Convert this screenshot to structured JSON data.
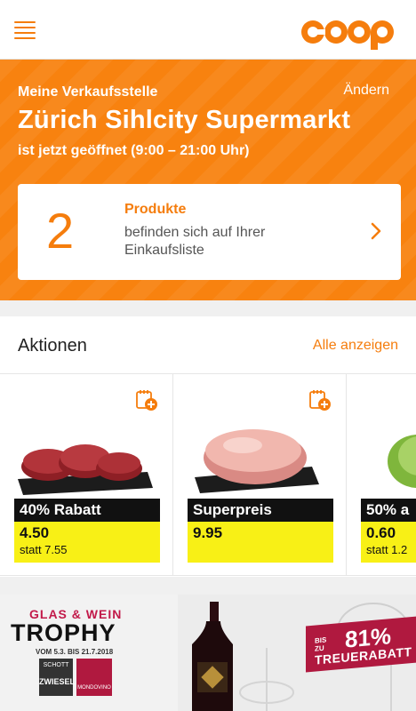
{
  "header": {
    "menu_icon": "hamburger-menu-icon",
    "logo_text": "coop",
    "brand_color": "#f57d0d"
  },
  "store": {
    "label": "Meine Verkaufsstelle",
    "change_label": "Ändern",
    "name": "Zürich Sihlcity Supermarkt",
    "hours": "ist jetzt geöffnet (9:00 – 21:00 Uhr)"
  },
  "shopping_list": {
    "count": "2",
    "title": "Produkte",
    "desc_line1": "befinden sich auf Ihrer",
    "desc_line2": "Einkaufsliste"
  },
  "aktionen": {
    "title": "Aktionen",
    "link": "Alle anzeigen",
    "deals": [
      {
        "tag": "40% Rabatt",
        "price": "4.50",
        "statt": "statt 7.55",
        "image": "beef-steaks"
      },
      {
        "tag": "Superpreis",
        "price": "9.95",
        "statt": "",
        "image": "pork-roast"
      },
      {
        "tag": "50% a",
        "price": "0.60",
        "statt": "statt 1.2",
        "image": "lettuce"
      }
    ]
  },
  "banner": {
    "line1": "GLAS & WEIN",
    "line2": "TROPHY",
    "date": "VOM 5.3. BIS 21.7.2018",
    "brand1_small": "SCHOTT",
    "brand1_big": "ZWIESEL",
    "brand2": "MONDOVINO",
    "badge_small": "BIS ZU",
    "badge_pct": "81%",
    "badge_label": "TREUERABATT"
  }
}
